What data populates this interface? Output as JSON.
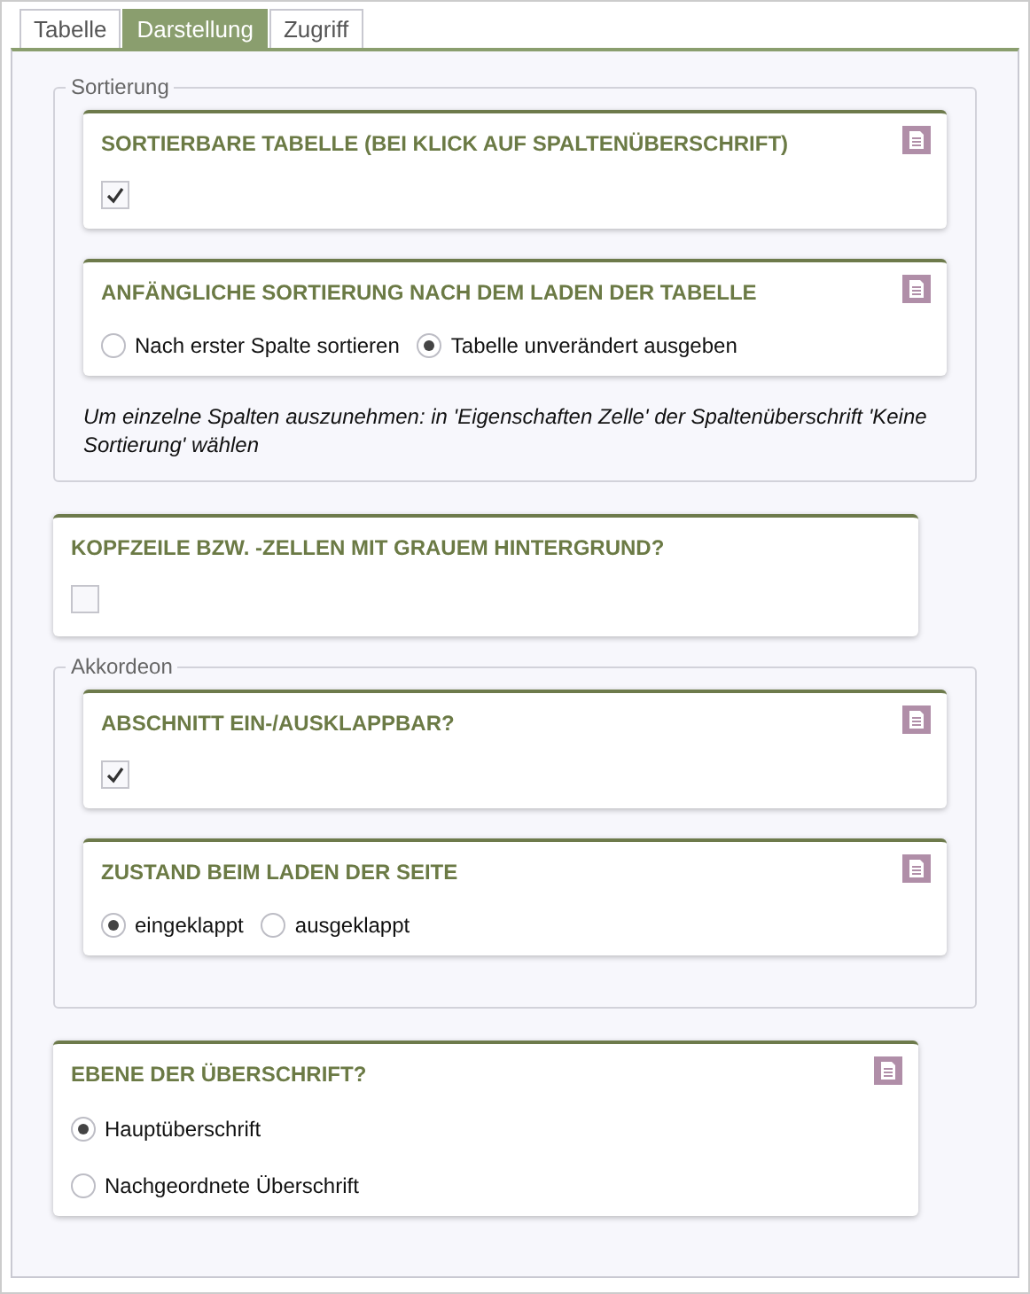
{
  "tabs": [
    {
      "label": "Tabelle",
      "selected": false
    },
    {
      "label": "Darstellung",
      "selected": true
    },
    {
      "label": "Zugriff",
      "selected": false
    }
  ],
  "sections": [
    {
      "kind": "group",
      "legend": "Sortierung",
      "fields": [
        {
          "kind": "checkbox",
          "title": "SORTIERBARE TABELLE (BEI KLICK AUF SPALTENÜBERSCHRIFT)",
          "help_icon": true,
          "checked": true
        },
        {
          "kind": "radio",
          "title": "ANFÄNGLICHE SORTIERUNG NACH DEM LADEN DER TABELLE",
          "help_icon": true,
          "options": [
            {
              "label": "Nach erster Spalte sortieren",
              "selected": false
            },
            {
              "label": "Tabelle unverändert ausgeben",
              "selected": true
            }
          ]
        }
      ],
      "note": "Um einzelne Spalten auszunehmen: in 'Eigenschaften Zelle' der Spaltenüberschrift 'Keine Sortierung' wählen"
    },
    {
      "kind": "field",
      "field": {
        "kind": "checkbox",
        "title": "KOPFZEILE BZW. -ZELLEN MIT GRAUEM HINTERGRUND?",
        "help_icon": false,
        "checked": false
      }
    },
    {
      "kind": "group",
      "legend": "Akkordeon",
      "fields": [
        {
          "kind": "checkbox",
          "title": "ABSCHNITT EIN-/AUSKLAPPBAR?",
          "help_icon": true,
          "checked": true
        },
        {
          "kind": "radio",
          "title": "ZUSTAND BEIM LADEN DER SEITE",
          "help_icon": true,
          "options": [
            {
              "label": "eingeklappt",
              "selected": true
            },
            {
              "label": "ausgeklappt",
              "selected": false
            }
          ]
        }
      ]
    },
    {
      "kind": "field",
      "field": {
        "kind": "radiolist",
        "title": "EBENE DER ÜBERSCHRIFT?",
        "help_icon": true,
        "options": [
          {
            "label": "Hauptüberschrift",
            "selected": true
          },
          {
            "label": "Nachgeordnete Überschrift",
            "selected": false
          }
        ]
      }
    }
  ]
}
